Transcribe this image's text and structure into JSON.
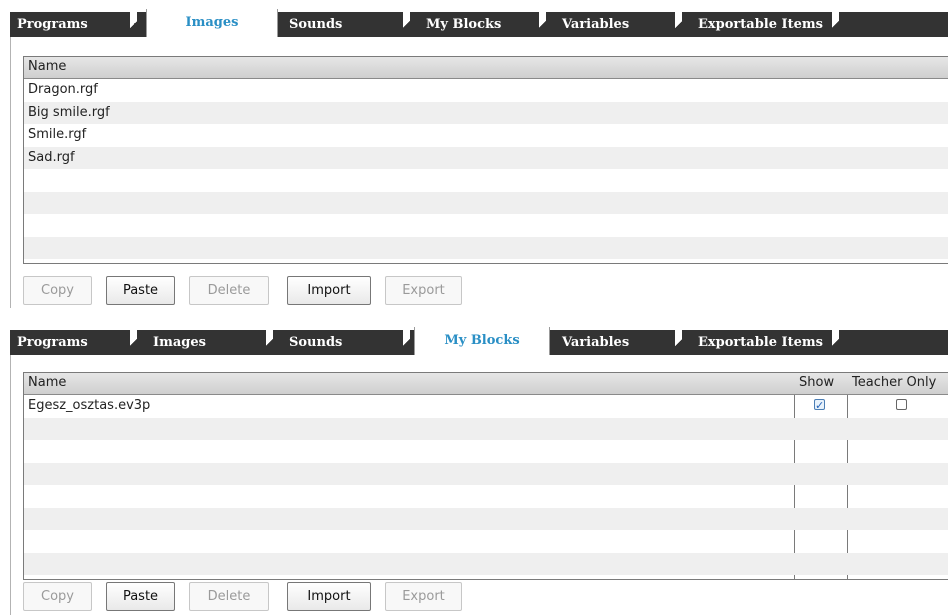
{
  "tabs": [
    "Programs",
    "Images",
    "Sounds",
    "My Blocks",
    "Variables",
    "Exportable Items"
  ],
  "panel1": {
    "active_tab": "Images",
    "table": {
      "header": "Name",
      "rows": [
        "Dragon.rgf",
        "Big smile.rgf",
        "Smile.rgf",
        "Sad.rgf"
      ]
    },
    "buttons": {
      "copy": {
        "label": "Copy",
        "enabled": false
      },
      "paste": {
        "label": "Paste",
        "enabled": true
      },
      "delete": {
        "label": "Delete",
        "enabled": false
      },
      "import": {
        "label": "Import",
        "enabled": true
      },
      "export": {
        "label": "Export",
        "enabled": false
      }
    }
  },
  "panel2": {
    "active_tab": "My Blocks",
    "table": {
      "headers": {
        "name": "Name",
        "show": "Show",
        "teacher_only": "Teacher Only"
      },
      "rows": [
        {
          "name": "Egesz_osztas.ev3p",
          "show": true,
          "teacher_only": false
        }
      ]
    },
    "buttons": {
      "copy": {
        "label": "Copy",
        "enabled": false
      },
      "paste": {
        "label": "Paste",
        "enabled": true
      },
      "delete": {
        "label": "Delete",
        "enabled": false
      },
      "import": {
        "label": "Import",
        "enabled": true
      },
      "export": {
        "label": "Export",
        "enabled": false
      }
    }
  },
  "colors": {
    "tab_bg": "#333333",
    "active_tab_text": "#2a8fc5",
    "row_alt": "#efefef"
  }
}
